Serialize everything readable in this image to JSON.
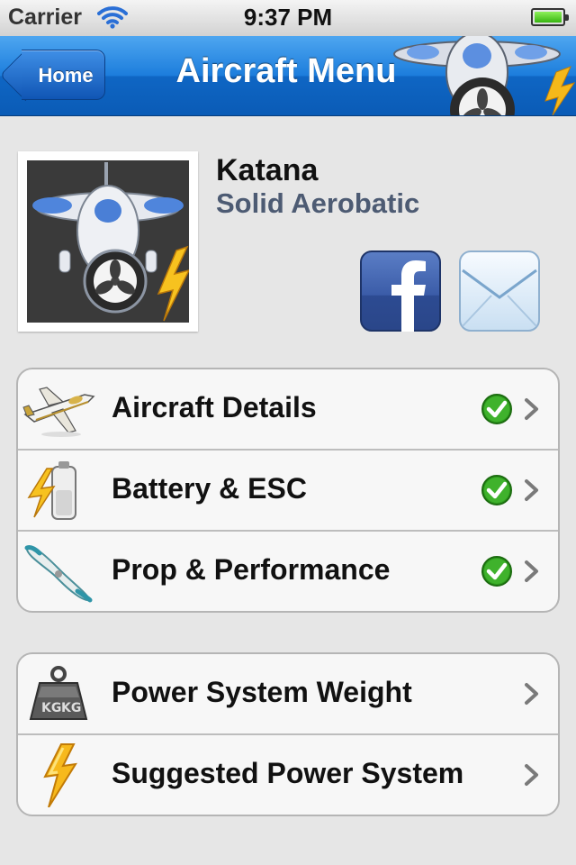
{
  "status_bar": {
    "carrier": "Carrier",
    "time": "9:37 PM"
  },
  "nav": {
    "back_label": "Home",
    "title": "Aircraft Menu"
  },
  "aircraft": {
    "name": "Katana",
    "type": "Solid Aerobatic"
  },
  "share": {
    "facebook_icon": "facebook-icon",
    "mail_icon": "mail-icon"
  },
  "groups": [
    {
      "rows": [
        {
          "label": "Aircraft Details",
          "icon": "airplane-icon",
          "completed": true
        },
        {
          "label": "Battery & ESC",
          "icon": "battery-bolt-icon",
          "completed": true
        },
        {
          "label": "Prop & Performance",
          "icon": "propeller-icon",
          "completed": true
        }
      ]
    },
    {
      "rows": [
        {
          "label": "Power System Weight",
          "icon": "kg-weight-icon",
          "completed": false
        },
        {
          "label": "Suggested Power System",
          "icon": "lightning-icon",
          "completed": false
        }
      ]
    }
  ],
  "colors": {
    "navbar": "#1c7ddc",
    "check_green": "#2e9d1e",
    "subtitle": "#4d5b73"
  }
}
